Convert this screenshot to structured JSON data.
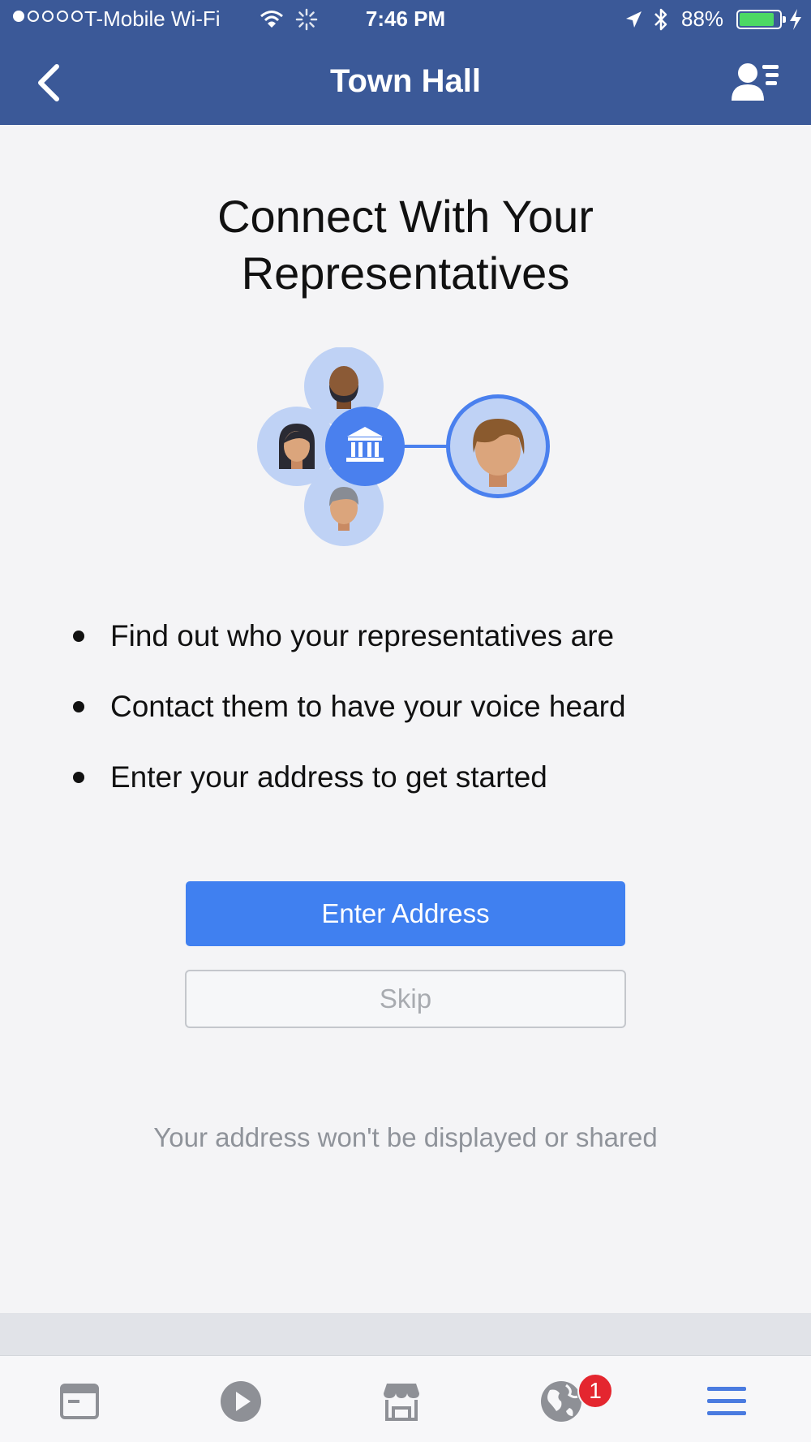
{
  "status_bar": {
    "signal_bars_filled": 1,
    "signal_bars_total": 5,
    "carrier": "T-Mobile Wi-Fi",
    "time": "7:46 PM",
    "battery_percent": "88%",
    "battery_level": 0.88,
    "icons": [
      "wifi-icon",
      "activity-spinner-icon",
      "location-arrow-icon",
      "bluetooth-icon",
      "battery-icon",
      "charging-bolt-icon"
    ]
  },
  "nav": {
    "title": "Town Hall",
    "back_icon": "chevron-left-icon",
    "profile_icon": "person-list-icon"
  },
  "main": {
    "headline_line1": "Connect With Your",
    "headline_line2": "Representatives",
    "illustration": "representatives-connect-illustration",
    "bullets": [
      "Find out who your representatives are",
      "Contact them to have your voice heard",
      "Enter your address to get started"
    ],
    "primary_button": "Enter Address",
    "secondary_button": "Skip",
    "privacy_note": "Your address won't be displayed or shared"
  },
  "tab_bar": {
    "tabs": [
      {
        "name": "news-feed-icon"
      },
      {
        "name": "video-play-icon"
      },
      {
        "name": "marketplace-store-icon"
      },
      {
        "name": "globe-notifications-icon",
        "badge": "1"
      },
      {
        "name": "menu-icon",
        "active": true
      }
    ]
  },
  "colors": {
    "brand": "#3b5998",
    "primary_button": "#4080f0",
    "background": "#f4f4f6",
    "badge": "#e4262f",
    "active_tab": "#4a7be0",
    "inactive_tab": "#8e9096"
  }
}
